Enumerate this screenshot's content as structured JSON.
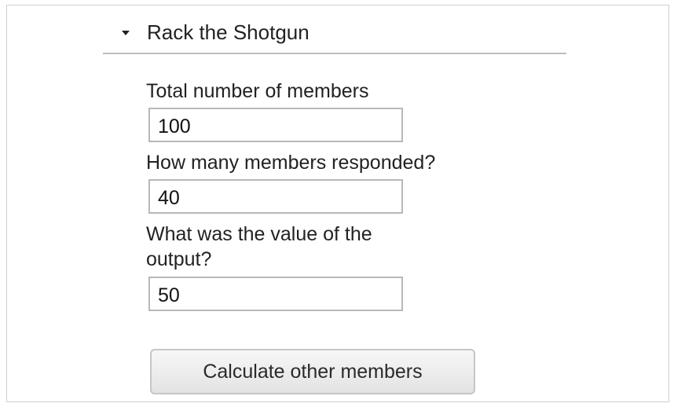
{
  "section": {
    "title": "Rack the Shotgun",
    "toggle_icon": "triangle-down-icon"
  },
  "form": {
    "total_members": {
      "label": "Total number of members",
      "value": "100"
    },
    "responded": {
      "label": "How many members responded?",
      "value": "40"
    },
    "output_value": {
      "label_line1": "What was the value of the",
      "label_line2": "output?",
      "value": "50"
    },
    "calculate_button": {
      "label": "Calculate other members"
    }
  }
}
